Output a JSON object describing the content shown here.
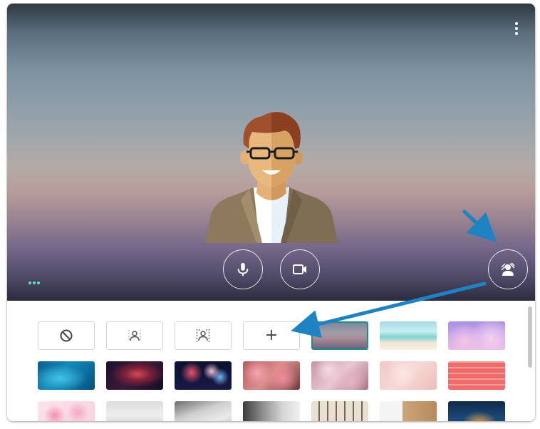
{
  "preview": {
    "more_icon": "more-vert-icon",
    "mic_icon": "microphone-icon",
    "camera_icon": "videocam-icon",
    "effects_icon": "background-effects-icon",
    "status_icon": "connection-dots-icon"
  },
  "backgrounds": {
    "options": [
      {
        "name": "no-effect",
        "icon": "block-icon"
      },
      {
        "name": "slight-blur",
        "icon": "blur-person-light-icon"
      },
      {
        "name": "blur",
        "icon": "blur-person-strong-icon"
      },
      {
        "name": "add-background",
        "icon": "plus-icon",
        "label": "+"
      }
    ],
    "selected": "sunset-gradient",
    "thumbnails": [
      "sunset-gradient",
      "beach",
      "pink-clouds",
      "blue-water",
      "galaxy-nebula",
      "fireworks",
      "pink-flowers",
      "cherry-blossoms",
      "pink-sparkle",
      "pink-pattern",
      "confetti-pink",
      "white-office",
      "white-room",
      "gray-studio",
      "bookshelf",
      "shelves",
      "night-house"
    ]
  },
  "colors": {
    "accent_arrow": "#1f82c2",
    "selected_border": "#1f8d84",
    "status_dots": "#5be3c8"
  }
}
